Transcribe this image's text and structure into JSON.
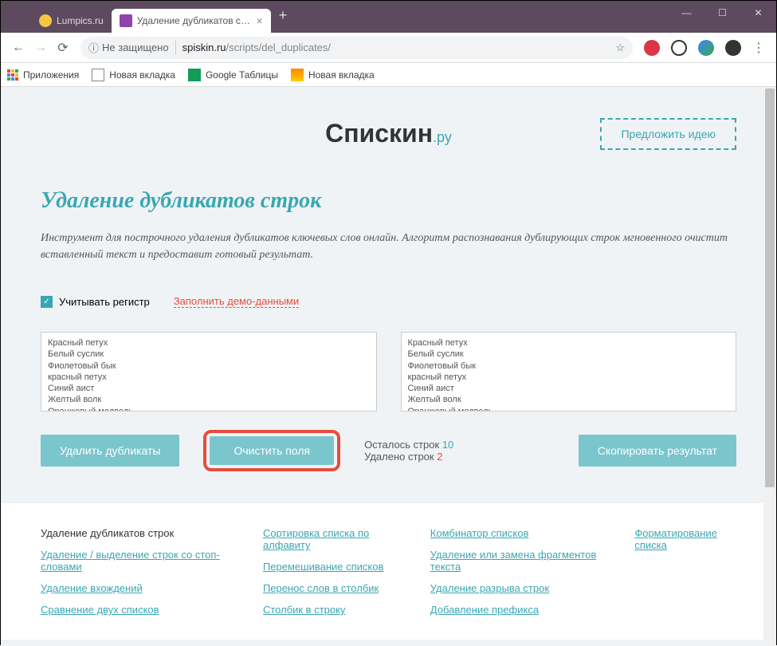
{
  "tabs": [
    {
      "title": "Lumpics.ru"
    },
    {
      "title": "Удаление дубликатов строк - у..."
    }
  ],
  "address": {
    "security": "Не защищено",
    "domain": "spiskin.ru",
    "path": "/scripts/del_duplicates/"
  },
  "bookmarks": {
    "apps": "Приложения",
    "newtab1": "Новая вкладка",
    "gtables": "Google Таблицы",
    "newtab2": "Новая вкладка"
  },
  "logo": {
    "main": "Спискин",
    "suffix": ".ру"
  },
  "suggest": "Предложить идею",
  "title": "Удаление дубликатов строк",
  "description": "Инструмент для построчного удаления дубликатов ключевых слов онлайн. Алгоритм распознавания дублирующих строк мгновенного очистит вставленный текст и предоставит готовый результат.",
  "options": {
    "case_sensitive": "Учитывать регистр",
    "demo": "Заполнить демо-данными"
  },
  "input_text": "Красный петух\nБелый суслик\nФиолетовый бык\nкрасный петух\nСиний аист\nЖелтый волк\nОранжевый медведь\nСиний аист",
  "output_text": "Красный петух\nБелый суслик\nФиолетовый бык\nкрасный петух\nСиний аист\nЖелтый волк\nОранжевый медведь\nЧерный страус",
  "buttons": {
    "remove": "Удалить дубликаты",
    "clear": "Очистить поля",
    "copy": "Скопировать результат"
  },
  "stats": {
    "remaining_label": "Осталось строк ",
    "remaining_val": "10",
    "removed_label": "Удалено строк ",
    "removed_val": "2"
  },
  "footer": {
    "col1": {
      "heading": "Удаление дубликатов строк",
      "l1": "Удаление / выделение строк со стоп-словами",
      "l2": "Удаление вхождений",
      "l3": "Сравнение двух списков"
    },
    "col2": {
      "l1": "Сортировка списка по алфавиту",
      "l2": "Перемешивание списков",
      "l3": "Перенос слов в столбик",
      "l4": "Столбик в строку"
    },
    "col3": {
      "l1": "Комбинатор списков",
      "l2": "Удаление или замена фрагментов текста",
      "l3": "Удаление разрыва строк",
      "l4": "Добавление префикса"
    },
    "col4": {
      "l1": "Форматирование списка"
    }
  }
}
